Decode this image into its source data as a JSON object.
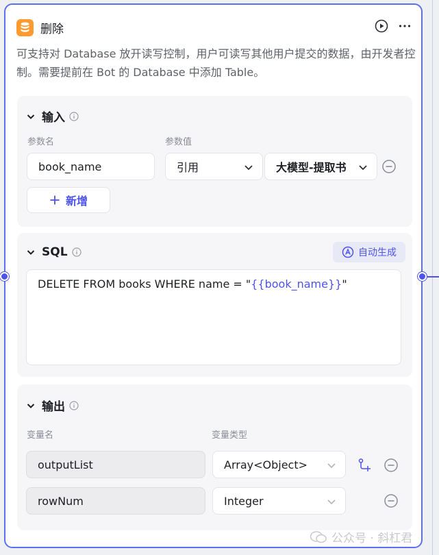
{
  "node": {
    "title": "删除",
    "description": "可支持对 Database 放开读写控制，用户可读写其他用户提交的数据，由开发者控制。需要提前在 Bot 的 Database 中添加 Table。"
  },
  "input_section": {
    "title": "输入",
    "param_name_label": "参数名",
    "param_value_label": "参数值",
    "params": [
      {
        "name": "book_name",
        "type": "引用",
        "source": "大模型-提取书"
      }
    ],
    "add_label": "新增"
  },
  "sql_section": {
    "title": "SQL",
    "auto_label": "自动生成",
    "query_prefix": "DELETE FROM books WHERE name = \"",
    "query_var": "{{book_name}}",
    "query_suffix": "\""
  },
  "output_section": {
    "title": "输出",
    "var_name_label": "变量名",
    "var_type_label": "变量类型",
    "vars": [
      {
        "name": "outputList",
        "type": "Array<Object>"
      },
      {
        "name": "rowNum",
        "type": "Integer"
      }
    ]
  },
  "watermark": "公众号 · 斜杠君",
  "colors": {
    "accent": "#4d53e8",
    "db_icon": "#ff9a2e"
  }
}
